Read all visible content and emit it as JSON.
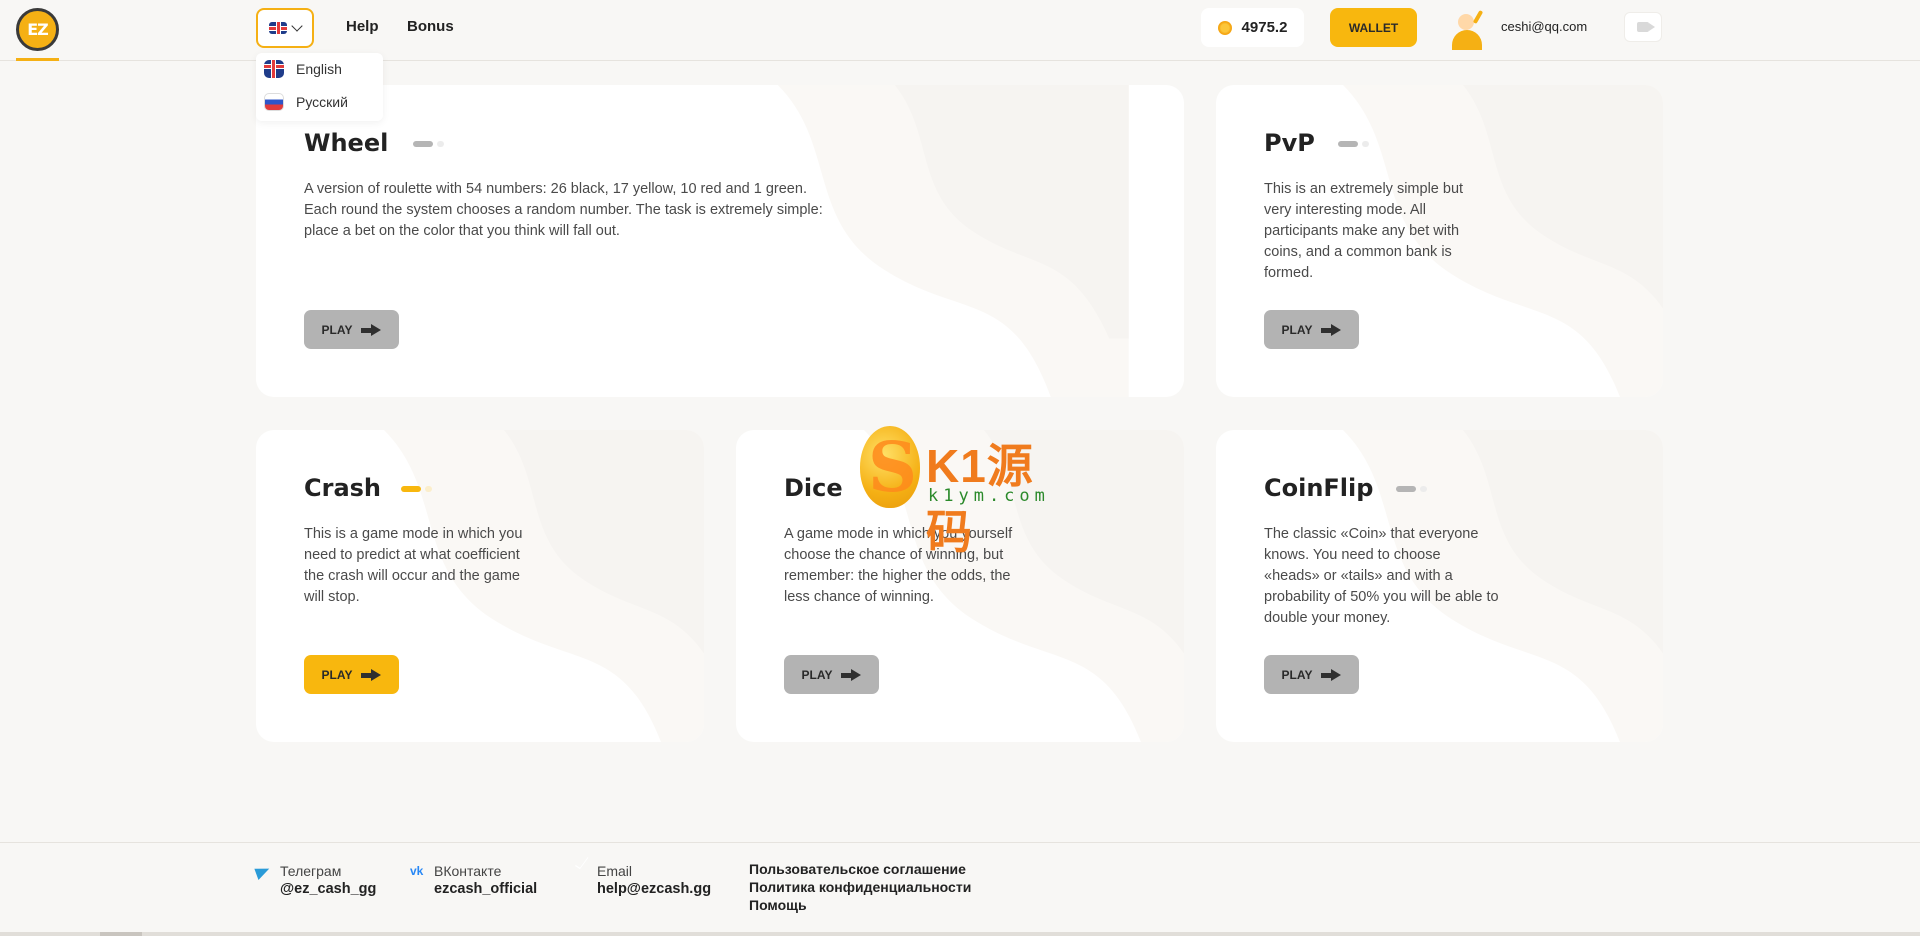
{
  "header": {
    "logo_text": "EZ",
    "nav": {
      "help": "Help",
      "bonus": "Bonus"
    },
    "balance": "4975.2",
    "wallet_label": "WALLET",
    "user_email": "ceshi@qq.com"
  },
  "language_menu": {
    "options": [
      {
        "label": "English",
        "flag": "uk-flag-icon"
      },
      {
        "label": "Русский",
        "flag": "ru-flag-icon"
      }
    ]
  },
  "games": [
    {
      "title": "Wheel",
      "desc": "A version of roulette with 54 numbers: 26 black, 17 yellow, 10 red and 1 green. Each round the system chooses a random number. The task is extremely simple: place a bet on the color that you think will fall out.",
      "play": "PLAY",
      "active": false
    },
    {
      "title": "PvP",
      "desc": "This is an extremely simple but very interesting mode. All participants make any bet with coins, and a common bank is formed.",
      "play": "PLAY",
      "active": false
    },
    {
      "title": "Crash",
      "desc": "This is a game mode in which you need to predict at what coefficient the crash will occur and the game will stop.",
      "play": "PLAY",
      "active": true
    },
    {
      "title": "Dice",
      "desc": "A game mode in which you yourself choose the chance of winning, but remember: the higher the odds, the less chance of winning.",
      "play": "PLAY",
      "active": false
    },
    {
      "title": "CoinFlip",
      "desc": "The classic «Coin» that everyone knows. You need to choose «heads» or «tails» and with a probability of 50% you will be able to double your money.",
      "play": "PLAY",
      "active": false
    }
  ],
  "watermark": {
    "main": "K1源码",
    "sub": "k1ym.com"
  },
  "footer": {
    "telegram": {
      "label": "Телеграм",
      "value": "@ez_cash_gg"
    },
    "vk": {
      "label": "ВКонтакте",
      "value": "ezcash_official"
    },
    "email": {
      "label": "Email",
      "value": "help@ezcash.gg"
    },
    "links": [
      "Пользовательское соглашение",
      "Политика конфиденциальности",
      "Помощь"
    ]
  },
  "colors": {
    "accent": "#f8b70e",
    "inactive_button": "#b3b3b3",
    "background": "#f8f7f5",
    "card": "#ffffff"
  }
}
